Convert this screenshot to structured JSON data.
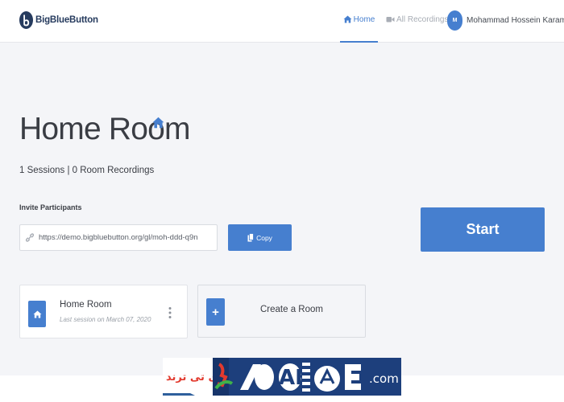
{
  "app": {
    "logo_text": "BigBlueButton"
  },
  "nav": {
    "home_label": "Home",
    "recordings_label": "All Recordings",
    "user_initial": "M",
    "user_name": "Mohammad Hossein Karami"
  },
  "room": {
    "title": "Home Room",
    "stats": "1 Sessions | 0 Room Recordings",
    "invite_label": "Invite Participants",
    "invite_url": "https://demo.bigbluebutton.org/gl/moh-ddd-q9n",
    "copy_label": "Copy",
    "start_label": "Start"
  },
  "rooms_list": [
    {
      "name": "Home Room",
      "subtitle": "Last session on March 07, 2020"
    }
  ],
  "create_room": {
    "icon": "+",
    "label": "Create a Room"
  },
  "watermark": {
    "text_fa": "آی تی ترند",
    "text_en": ".com"
  },
  "icons": {
    "logo": "bigbluebutton-logo-icon",
    "home": "home-icon",
    "recordings": "video-camera-icon",
    "link": "link-icon",
    "copy": "copy-icon",
    "menu": "vertical-ellipsis-icon",
    "plus": "plus-icon"
  },
  "colors": {
    "accent": "#467fcf",
    "background": "#f4f5f8",
    "navbar": "#ffffff",
    "logo_text": "#263b5e",
    "muted_nav": "#a8adb5"
  }
}
